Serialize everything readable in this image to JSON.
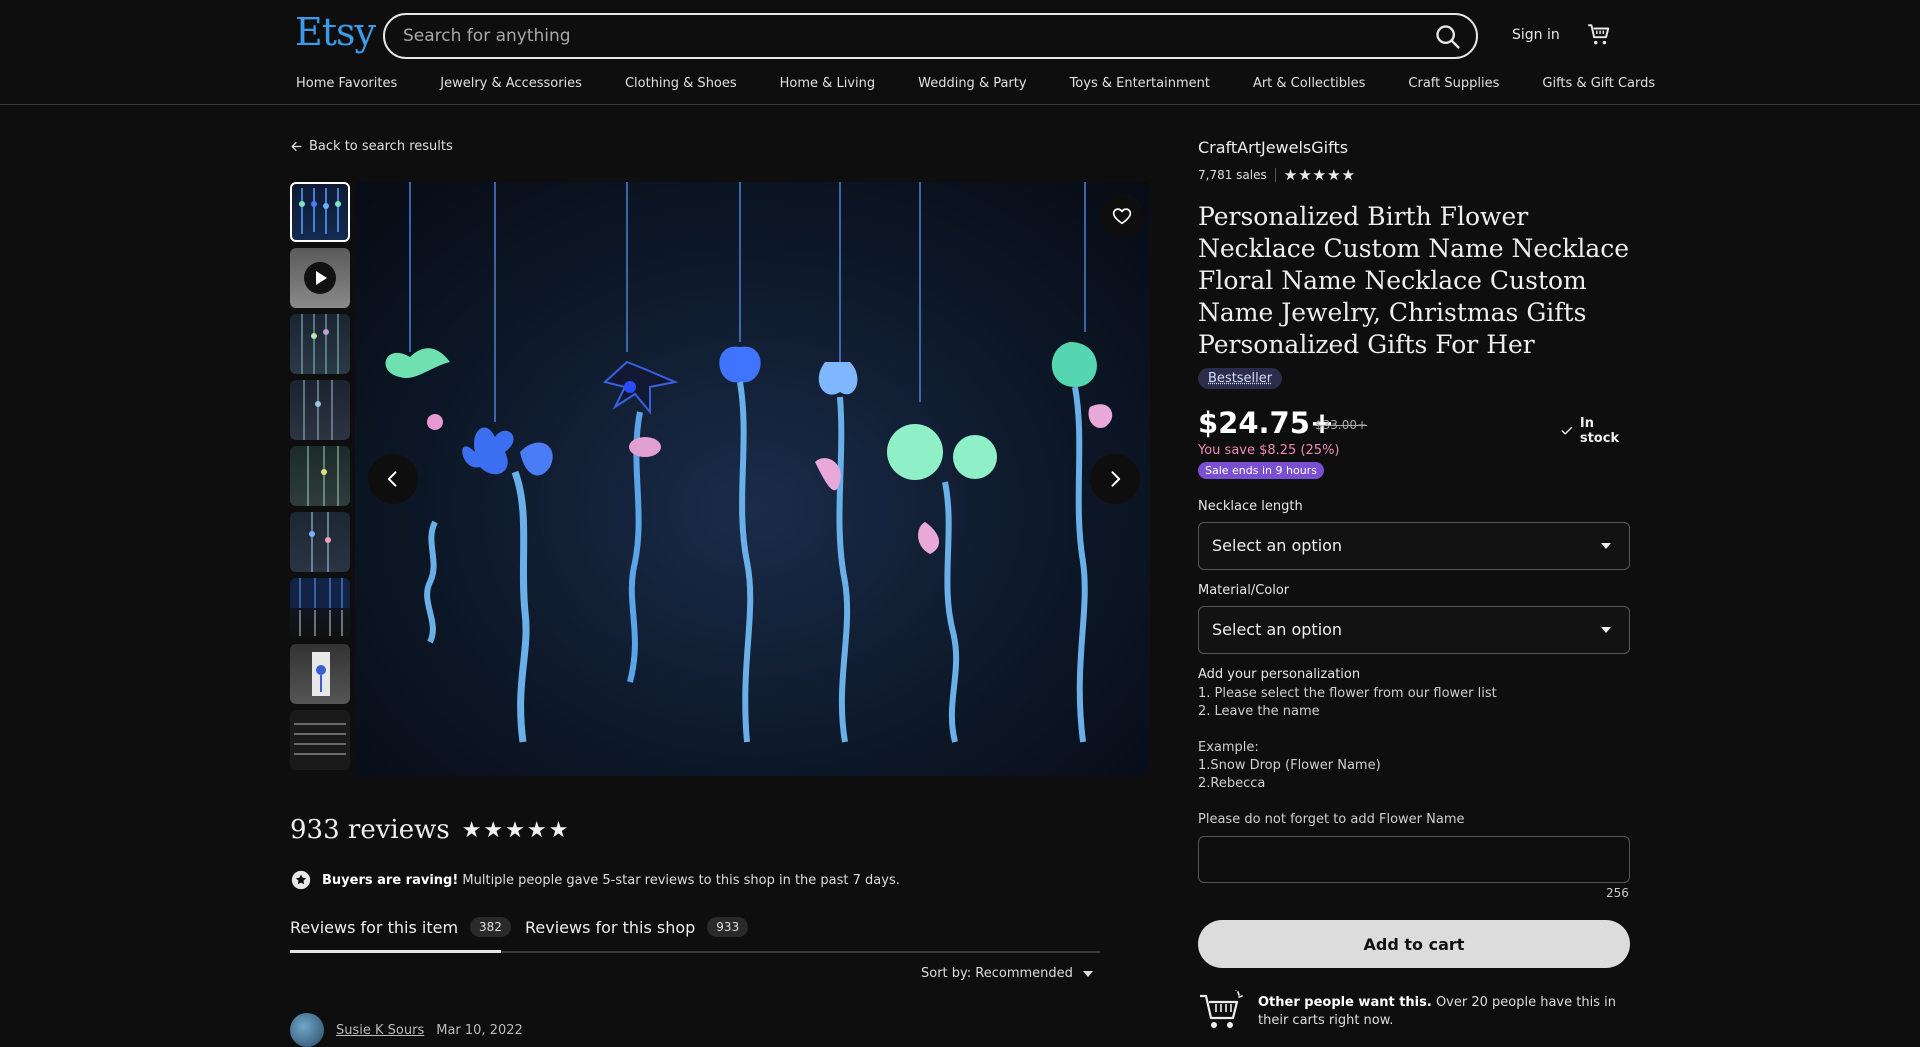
{
  "header": {
    "logo": "Etsy",
    "search_placeholder": "Search for anything",
    "signin": "Sign in"
  },
  "categories": [
    "Home Favorites",
    "Jewelry & Accessories",
    "Clothing & Shoes",
    "Home & Living",
    "Wedding & Party",
    "Toys & Entertainment",
    "Art & Collectibles",
    "Craft Supplies",
    "Gifts & Gift Cards"
  ],
  "back_link": "Back to search results",
  "listing": {
    "shop_name": "CraftArtJewelsGifts",
    "sales": "7,781 sales",
    "shop_stars": "★★★★★",
    "title": "Personalized Birth Flower Necklace Custom Name Necklace Floral Name Necklace Custom Name Jewelry, Christmas Gifts Personalized Gifts For Her",
    "badge": "Bestseller",
    "price": "$24.75+",
    "old_price": "$33.00+",
    "stock": "In stock",
    "you_save": "You save $8.25 (25%)",
    "sale_ends": "Sale ends in 9 hours",
    "necklace_length_label": "Necklace length",
    "necklace_length_value": "Select an option",
    "material_label": "Material/Color",
    "material_value": "Select an option",
    "personalization_label": "Add your personalization",
    "instr_1": "1. Please select the flower from our flower list",
    "instr_2": "2. Leave the name",
    "example_label": "Example:",
    "example_1": "1.Snow Drop (Flower Name)",
    "example_2": "2.Rebecca",
    "reminder": "Please do not forget to add Flower Name",
    "char_count": "256",
    "add_to_cart": "Add to cart",
    "other_bold": "Other people want this.",
    "other_text": " Over 20 people have this in their carts right now."
  },
  "reviews": {
    "title": "933 reviews",
    "stars": "★★★★★",
    "raving_bold": "Buyers are raving!",
    "raving_text": " Multiple people gave 5-star reviews to this shop in the past 7 days.",
    "tab_item_label": "Reviews for this item",
    "tab_item_count": "382",
    "tab_shop_label": "Reviews for this shop",
    "tab_shop_count": "933",
    "sort_label": "Sort by: Recommended",
    "reviewer": "Susie K Sours",
    "review_date": "Mar 10, 2022"
  },
  "colors": {
    "brand": "#3b9be9",
    "sale_badge": "#7b4fd1",
    "save_text": "#f08ab6"
  }
}
